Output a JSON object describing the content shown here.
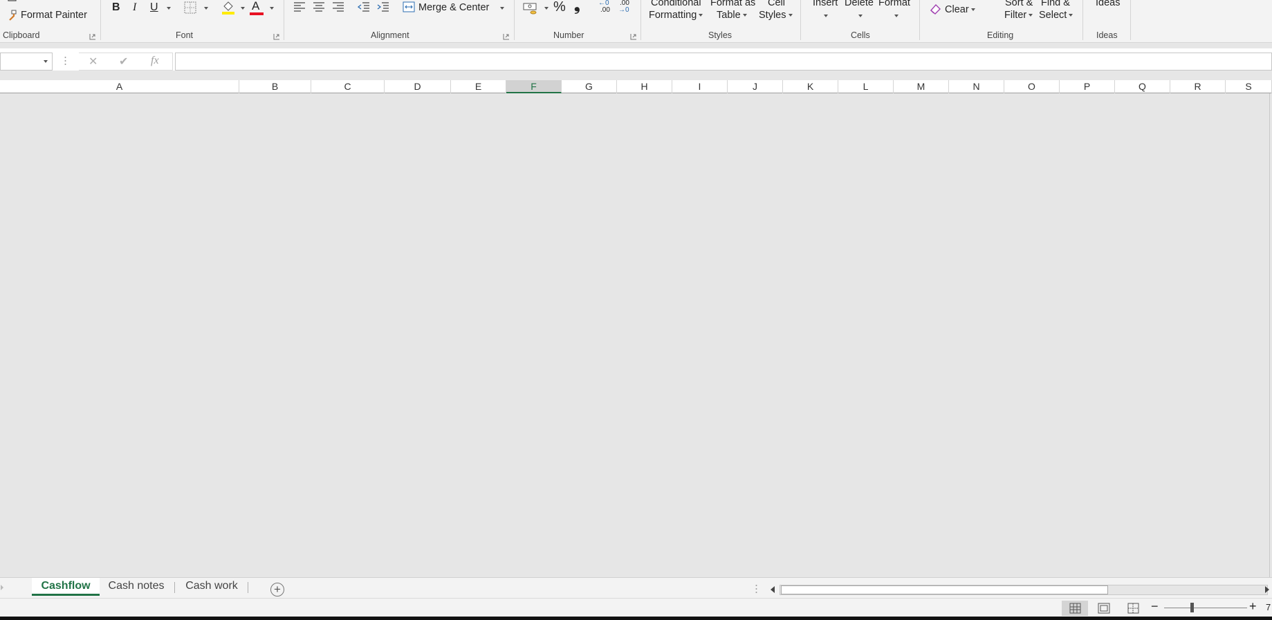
{
  "ribbon": {
    "clipboard": {
      "format_painter_label": "Format Painter",
      "group_label": "Clipboard"
    },
    "font": {
      "bold": "B",
      "italic": "I",
      "underline": "U",
      "font_color_letter": "A",
      "group_label": "Font",
      "highlight_color": "#ffeb00",
      "font_color": "#e81123"
    },
    "alignment": {
      "merge_center_label": "Merge & Center",
      "group_label": "Alignment"
    },
    "number": {
      "percent": "%",
      "comma": "❟",
      "inc_decimal_top": "←0",
      "inc_decimal_bottom": ".00",
      "dec_decimal_top": ".00",
      "dec_decimal_bottom": "→0",
      "group_label": "Number"
    },
    "styles": {
      "conditional_line1": "Conditional",
      "conditional_line2": "Formatting",
      "format_table_line1": "Format as",
      "format_table_line2": "Table",
      "cell_styles_line1": "Cell",
      "cell_styles_line2": "Styles",
      "group_label": "Styles"
    },
    "cells": {
      "insert_label": "Insert",
      "delete_label": "Delete",
      "format_label": "Format",
      "group_label": "Cells"
    },
    "editing": {
      "clear_label": "Clear",
      "sort_line1": "Sort &",
      "sort_line2": "Filter",
      "find_line1": "Find &",
      "find_line2": "Select",
      "group_label": "Editing"
    },
    "ideas": {
      "ideas_label": "Ideas",
      "group_label": "Ideas"
    }
  },
  "formula_bar": {
    "name_box_value": "",
    "cancel_icon": "✕",
    "enter_icon": "✔",
    "fx_label": "fx",
    "formula_value": ""
  },
  "columns": {
    "A": "A",
    "B": "B",
    "C": "C",
    "D": "D",
    "E": "E",
    "F": "F",
    "G": "G",
    "H": "H",
    "I": "I",
    "J": "J",
    "K": "K",
    "L": "L",
    "M": "M",
    "N": "N",
    "O": "O",
    "P": "P",
    "Q": "Q",
    "R": "R",
    "S": "S"
  },
  "selected_column": "F",
  "sheets": {
    "tab1": "Cashflow",
    "tab2": "Cash notes",
    "tab3": "Cash work",
    "add_icon": "+"
  },
  "status": {
    "zoom_text": "7"
  },
  "colors": {
    "accent": "#217346",
    "grid_bg": "#e6e6e6",
    "ribbon_bg": "#f3f3f3"
  }
}
